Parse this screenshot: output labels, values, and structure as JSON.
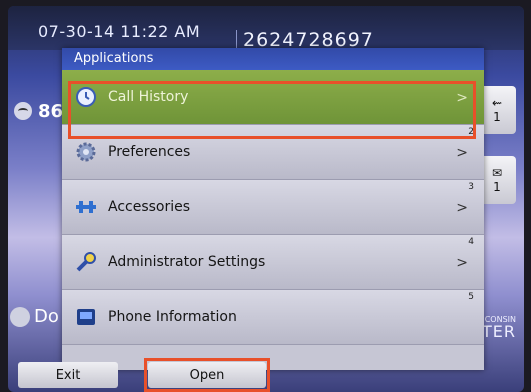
{
  "status_bar": {
    "datetime": "07-30-14 11:22 AM",
    "phone_number": "2624728697"
  },
  "left_line": {
    "text": "86"
  },
  "left_dnd": {
    "text": "Do"
  },
  "right_buttons": {
    "button1": "1",
    "button2": "1"
  },
  "brand": {
    "line1": "CONSIN",
    "line2": "TER"
  },
  "applications": {
    "title": "Applications",
    "items": [
      {
        "label": "Call History",
        "number": "",
        "selected": true
      },
      {
        "label": "Preferences",
        "number": "2",
        "selected": false
      },
      {
        "label": "Accessories",
        "number": "3",
        "selected": false
      },
      {
        "label": "Administrator Settings",
        "number": "4",
        "selected": false
      },
      {
        "label": "Phone Information",
        "number": "5",
        "selected": false
      }
    ]
  },
  "softkeys": {
    "exit": "Exit",
    "open": "Open"
  },
  "colors": {
    "highlight": "#e8502a",
    "selected_item": "#7ea042",
    "header": "#3b55bd"
  }
}
